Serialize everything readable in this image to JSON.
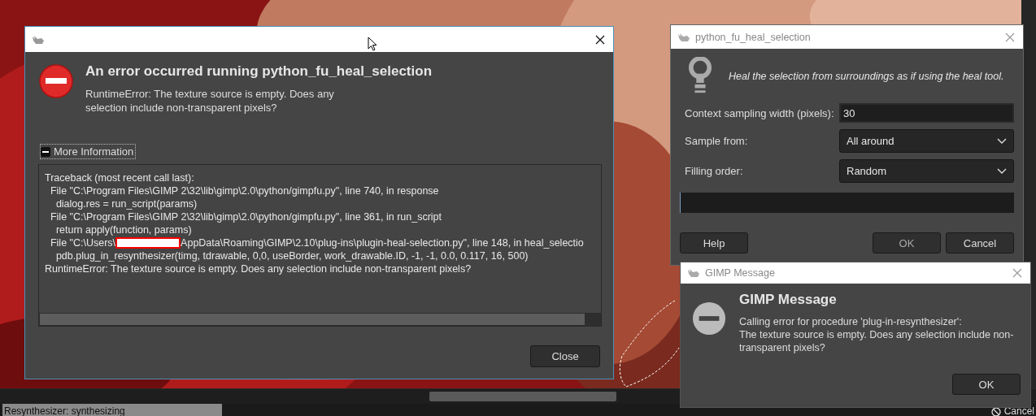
{
  "error_dialog": {
    "heading": "An error occurred running python_fu_heal_selection",
    "message": "RuntimeError: The texture source is empty. Does any selection include non-transparent pixels?",
    "details": {
      "label": "More Information",
      "expanded": true,
      "lines": [
        {
          "text": "Traceback (most recent call last):"
        },
        {
          "text": "  File \"C:\\Program Files\\GIMP 2\\32\\lib\\gimp\\2.0\\python/gimpfu.py\", line 740, in response"
        },
        {
          "text": "    dialog.res = run_script(params)"
        },
        {
          "text": "  File \"C:\\Program Files\\GIMP 2\\32\\lib\\gimp\\2.0\\python/gimpfu.py\", line 361, in run_script"
        },
        {
          "text": "    return apply(function, params)"
        },
        {
          "text": "  File \"C:\\Users\\",
          "redacted": true,
          "after": "AppData\\Roaming\\GIMP\\2.10\\plug-ins\\plugin-heal-selection.py\", line 148, in heal_selectio"
        },
        {
          "text": "    pdb.plug_in_resynthesizer(timg, tdrawable, 0,0, useBorder, work_drawable.ID, -1, -1, 0.0, 0.117, 16, 500)"
        },
        {
          "text": "RuntimeError: The texture source is empty. Does any selection include non-transparent pixels?"
        }
      ]
    },
    "buttons": [
      {
        "label": "Close"
      }
    ]
  },
  "heal_dialog": {
    "title": "python_fu_heal_selection",
    "description": "Heal the selection from surroundings as if using the heal tool.",
    "fields": [
      {
        "kind": "entry",
        "label": "Context sampling width (pixels):",
        "value": "30"
      },
      {
        "kind": "combo",
        "label": "Sample from:",
        "value": "All around"
      },
      {
        "kind": "combo",
        "label": "Filling order:",
        "value": "Random"
      }
    ],
    "progress": {
      "level": 0
    },
    "buttons": [
      {
        "label": "Help",
        "disabled": false
      },
      {
        "label": "OK",
        "disabled": true
      },
      {
        "label": "Cancel",
        "disabled": false
      }
    ]
  },
  "message_dialog": {
    "title": "GIMP Message",
    "heading": "GIMP Message",
    "lines": [
      "Calling error for procedure 'plug-in-resynthesizer':",
      "The texture source is empty. Does any selection include non-",
      "transparent pixels?"
    ],
    "buttons": [
      {
        "label": "OK"
      }
    ]
  },
  "status_bar": {
    "progress_text": "Resynthesizer: synthesizing",
    "level": 1,
    "cancel": "Cancel"
  }
}
